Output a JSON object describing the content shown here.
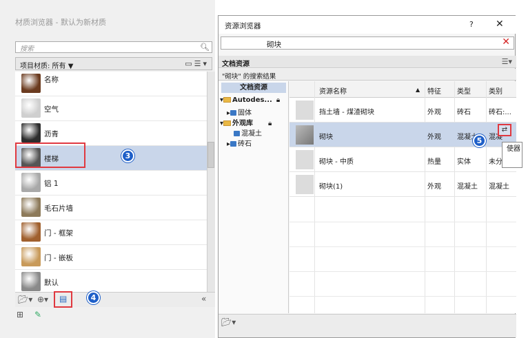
{
  "left": {
    "title": "材质浏览器 - 默认为新材质",
    "search_placeholder": "搜索",
    "filter_label": "项目材质: 所有 ▼",
    "name_header": "名称",
    "materials": [
      {
        "name": "",
        "thumb": "#6b3b1f"
      },
      {
        "name": "空气",
        "thumb": "#cfcfcf"
      },
      {
        "name": "沥青",
        "thumb": "#2d2d2d"
      },
      {
        "name": "楼梯",
        "thumb": "#555555"
      },
      {
        "name": "铝 1",
        "thumb": "#a9a9a9"
      },
      {
        "name": "毛石片墙",
        "thumb": "#8d7a5a"
      },
      {
        "name": "门 - 框架",
        "thumb": "#a0602e"
      },
      {
        "name": "门 - 嵌板",
        "thumb": "#c89a5a"
      },
      {
        "name": "默认",
        "thumb": "#8a8a8a"
      }
    ],
    "selected_index": 3
  },
  "badges": {
    "b3": "3",
    "b4": "4",
    "b5": "5"
  },
  "dialog": {
    "title": "资源浏览器",
    "help": "?",
    "close": "✕",
    "search_value": "砌块",
    "section": "文档资源",
    "results_label": "\"砌块\" 的搜索结果",
    "tree": {
      "header": "文档资源",
      "nodes": [
        {
          "label": "Autodes...",
          "kind": "folder"
        },
        {
          "label": "固体",
          "kind": "item"
        },
        {
          "label": "外观库",
          "kind": "folder"
        },
        {
          "label": "混凝土",
          "kind": "item"
        },
        {
          "label": "砖石",
          "kind": "item"
        }
      ]
    },
    "columns": [
      "资源名称",
      "特征",
      "类型",
      "类别"
    ],
    "rows": [
      {
        "name": "挡土墙 - 煤渣砌块",
        "feature": "外观",
        "type": "砖石",
        "category": "砖石:..."
      },
      {
        "name": "砌块",
        "feature": "外观",
        "type": "混凝土",
        "category": "混凝"
      },
      {
        "name": "砌块 - 中质",
        "feature": "热量",
        "type": "实体",
        "category": "未分"
      },
      {
        "name": "砌块(1)",
        "feature": "外观",
        "type": "混凝土",
        "category": "混凝土"
      }
    ],
    "tooltip": "使器"
  }
}
